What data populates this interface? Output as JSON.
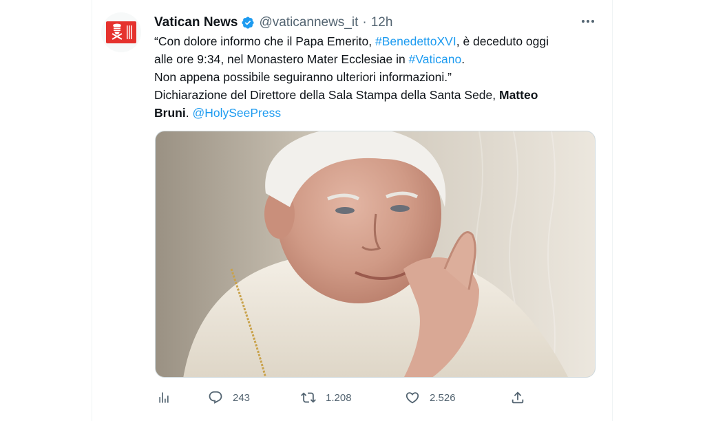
{
  "account": {
    "name": "Vatican News",
    "handle": "@vaticannews_it",
    "separator": "·",
    "time": "12h"
  },
  "tweet": {
    "line1_pre": "“Con dolore informo che il Papa Emerito, ",
    "hashtag1": "#BenedettoXVI",
    "line1_post": ", è deceduto oggi",
    "line2_pre": "alle ore 9:34, nel Monastero Mater Ecclesiae in ",
    "hashtag2": "#Vaticano",
    "line2_post": ".",
    "line3": "Non appena possibile seguiranno ulteriori informazioni.”",
    "line4_pre": "Dichiarazione del Direttore della Sala Stampa della Santa Sede, ",
    "bold_name_1": "Matteo",
    "bold_name_2": "Bruni",
    "line5_mid": ". ",
    "mention": "@HolySeePress"
  },
  "media": {
    "alt": "Portrait photo of Pope Emeritus Benedict XVI"
  },
  "actions": {
    "views_icon": "analytics-icon",
    "reply_count": "243",
    "retweet_count": "1.208",
    "like_count": "2.526",
    "share_icon": "share-icon"
  },
  "colors": {
    "accent": "#1d9bf0",
    "brand_red": "#e5322d",
    "text": "#0f1419",
    "muted": "#536471"
  }
}
